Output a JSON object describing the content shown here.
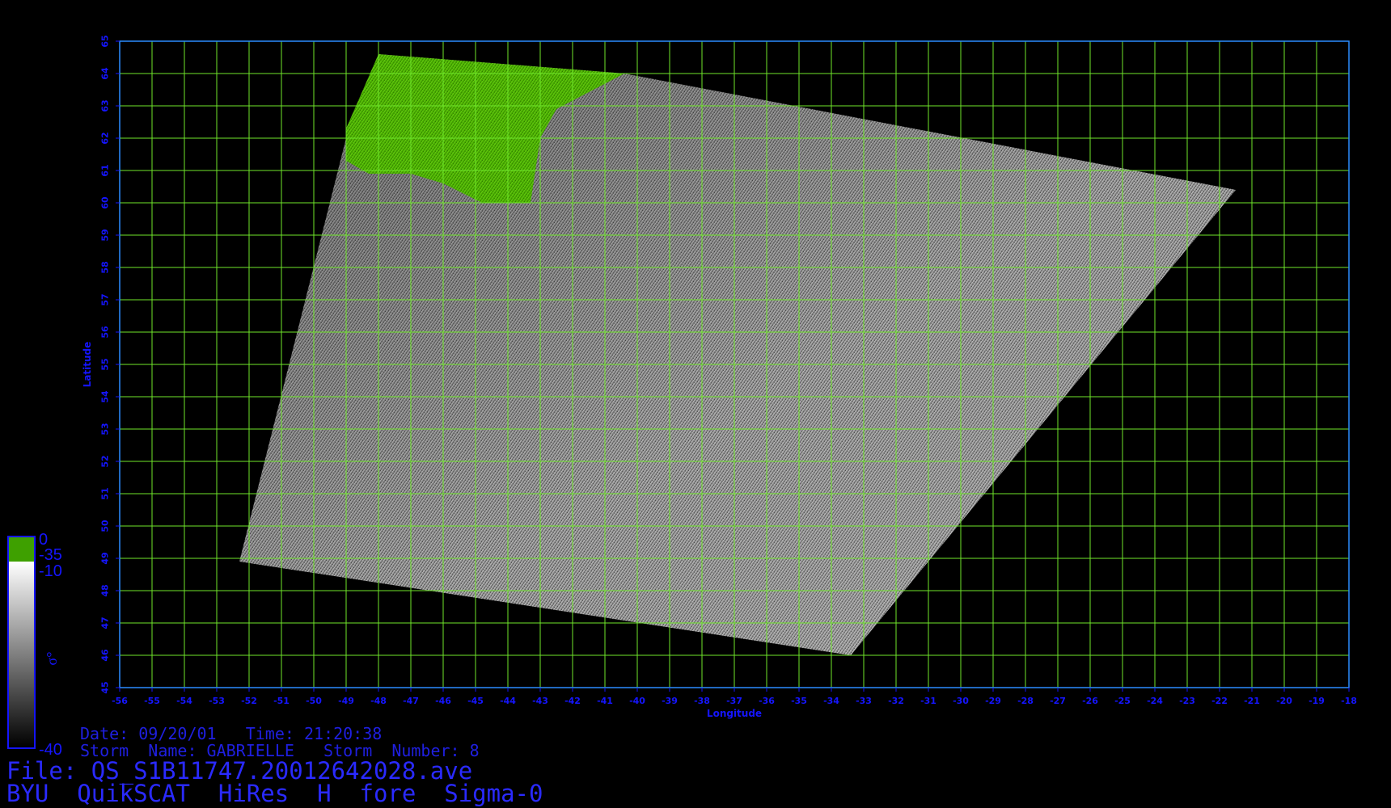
{
  "chart_data": {
    "type": "heatmap",
    "xlabel": "Longitude",
    "ylabel": "Latitude",
    "xlim": [
      -56,
      -18
    ],
    "ylim": [
      45,
      65
    ],
    "xticks": [
      -56,
      -55,
      -54,
      -53,
      -52,
      -51,
      -50,
      -49,
      -48,
      -47,
      -46,
      -45,
      -44,
      -43,
      -42,
      -41,
      -40,
      -39,
      -38,
      -37,
      -36,
      -35,
      -34,
      -33,
      -32,
      -31,
      -30,
      -29,
      -28,
      -27,
      -26,
      -25,
      -24,
      -23,
      -22,
      -21,
      -20,
      -19,
      -18
    ],
    "yticks": [
      45,
      46,
      47,
      48,
      49,
      50,
      51,
      52,
      53,
      54,
      55,
      56,
      57,
      58,
      59,
      60,
      61,
      62,
      63,
      64,
      65
    ],
    "grid": true,
    "swath_corners": [
      {
        "lon": -48.0,
        "lat": 64.6
      },
      {
        "lon": -40.4,
        "lat": 64.0
      },
      {
        "lon": -21.5,
        "lat": 60.4
      },
      {
        "lon": -33.4,
        "lat": 46.0
      },
      {
        "lon": -52.3,
        "lat": 48.9
      },
      {
        "lon": -49.0,
        "lat": 62.0
      }
    ],
    "land_region": [
      {
        "lon": -48.0,
        "lat": 64.6
      },
      {
        "lon": -40.4,
        "lat": 64.0
      },
      {
        "lon": -42.5,
        "lat": 62.9
      },
      {
        "lon": -43.0,
        "lat": 62.0
      },
      {
        "lon": -43.3,
        "lat": 60.0
      },
      {
        "lon": -44.8,
        "lat": 60.0
      },
      {
        "lon": -46.0,
        "lat": 60.6
      },
      {
        "lon": -47.0,
        "lat": 60.9
      },
      {
        "lon": -48.3,
        "lat": 60.9
      },
      {
        "lon": -49.0,
        "lat": 61.3
      },
      {
        "lon": -49.0,
        "lat": 62.3
      }
    ],
    "colorbar": {
      "label": "σ°",
      "top_label": "0",
      "mid_labels": [
        "-35",
        "-10"
      ],
      "bottom_label": "-40",
      "land_color": "#3ea000",
      "ocean_gradient": [
        "#ffffff",
        "#000000"
      ]
    },
    "colors": {
      "axes": "#1515ff",
      "grid": "#6fe62a",
      "frame": "#2a8cff"
    }
  },
  "meta": {
    "date_line": "Date: 09/20/01   Time: 21:20:38",
    "storm_line": "Storm  Name: GABRIELLE   Storm  Number: 8",
    "file_line": "File: QS_S1B11747.20012642028.ave",
    "title_line": "BYU  QuikSCAT  HiRes  H  fore  Sigma-0"
  }
}
